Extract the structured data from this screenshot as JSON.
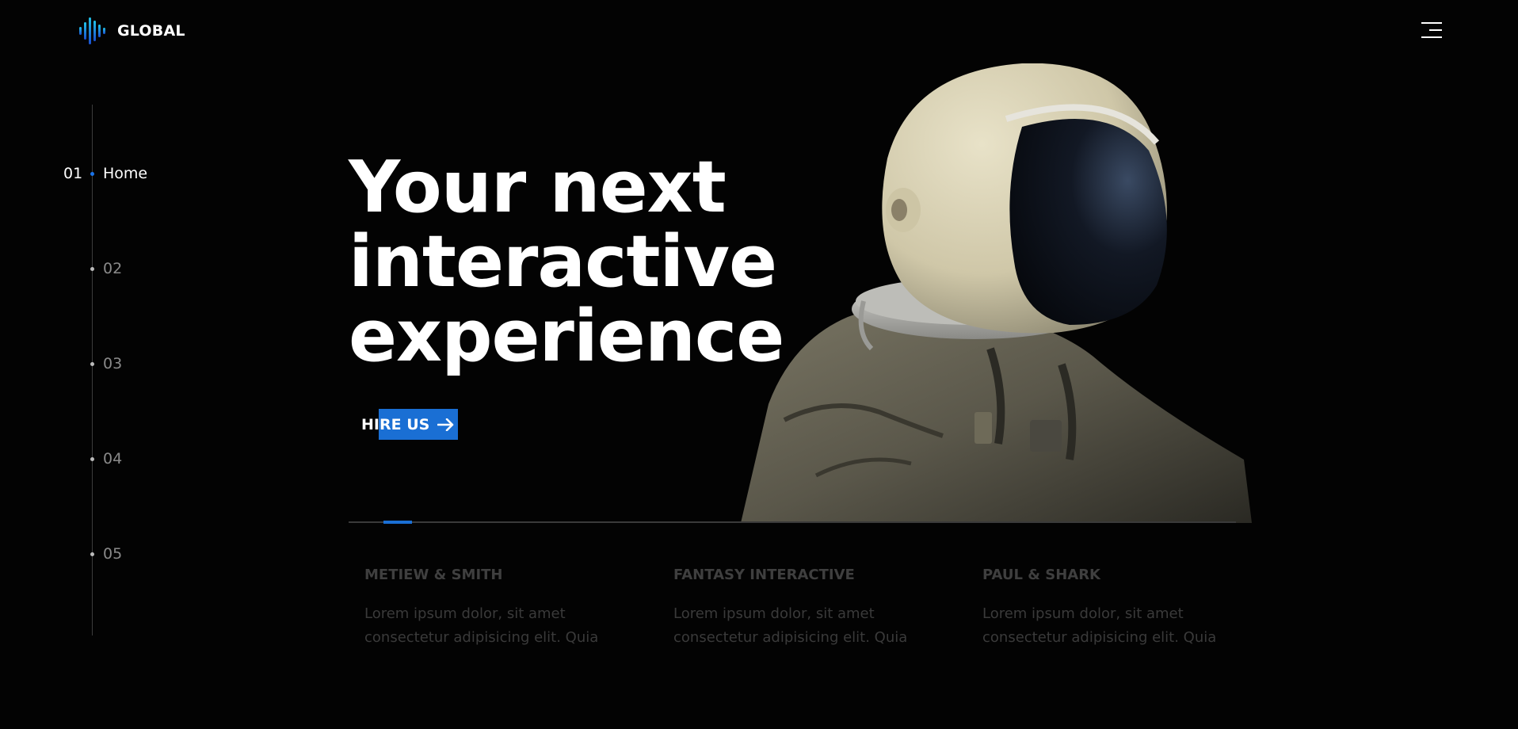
{
  "header": {
    "logo_text": "GLOBAL",
    "logo_icon": "sound-wave-icon",
    "menu_icon": "hamburger-menu-icon"
  },
  "side_nav": {
    "items": [
      {
        "num": "01",
        "label": "Home",
        "active": true
      },
      {
        "num": "",
        "label": "02",
        "active": false
      },
      {
        "num": "",
        "label": "03",
        "active": false
      },
      {
        "num": "",
        "label": "04",
        "active": false
      },
      {
        "num": "",
        "label": "05",
        "active": false
      }
    ]
  },
  "hero": {
    "title_lines": [
      "Your next",
      "interactive",
      "experience"
    ],
    "cta_label": "HIRE US",
    "cta_icon": "arrow-right-icon",
    "image": "astronaut-photo"
  },
  "slider": {
    "active_index": 1,
    "progress_fraction": 0.03
  },
  "cards": [
    {
      "title": "METIEW & SMITH",
      "text": "Lorem ipsum dolor, sit amet consectetur adipisicing elit. Quia"
    },
    {
      "title": "FANTASY INTERACTIVE",
      "text": "Lorem ipsum dolor, sit amet consectetur adipisicing elit. Quia"
    },
    {
      "title": "PAUL & SHARK",
      "text": "Lorem ipsum dolor, sit amet consectetur adipisicing elit. Quia"
    }
  ],
  "colors": {
    "background": "#030303",
    "accent": "#1a6fd4",
    "text": "#ffffff",
    "muted": "#8a8a8a"
  }
}
